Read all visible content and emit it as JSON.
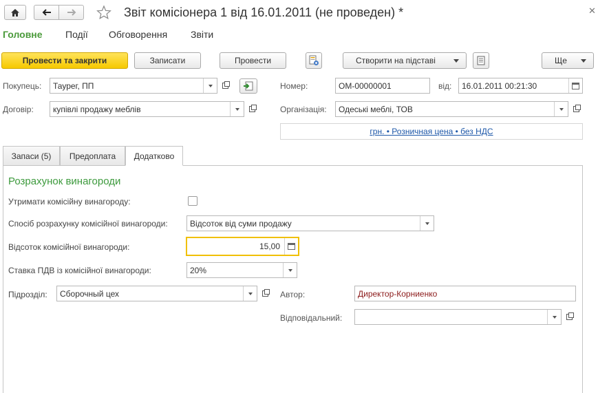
{
  "window": {
    "title": "Звіт комісіонера 1 від 16.01.2011 (не проведен) *"
  },
  "tabs": [
    {
      "label": "Головне",
      "active": true
    },
    {
      "label": "Події",
      "active": false
    },
    {
      "label": "Обговорення",
      "active": false
    },
    {
      "label": "Звіти",
      "active": false
    }
  ],
  "toolbar": {
    "post_close": "Провести та закрити",
    "save": "Записати",
    "post": "Провести",
    "create_based": "Створити на підставі",
    "more": "Ще"
  },
  "header": {
    "buyer_label": "Покупець:",
    "buyer_value": "Таурег, ПП",
    "contract_label": "Договір:",
    "contract_value": "купівлі продажу меблів",
    "number_label": "Номер:",
    "number_value": "ОМ-00000001",
    "date_label": "від:",
    "date_value": "16.01.2011 00:21:30",
    "org_label": "Організація:",
    "org_value": "Одеські меблі, ТОВ",
    "price_link": "грн. • Розничная цена • без НДС"
  },
  "doc_tabs": [
    {
      "label": "Запаси (5)",
      "active": false
    },
    {
      "label": "Предоплата",
      "active": false
    },
    {
      "label": "Додатково",
      "active": true
    }
  ],
  "commission": {
    "section_title": "Розрахунок винагороди",
    "withhold_label": "Утримати комісійну винагороду:",
    "withhold_checked": false,
    "method_label": "Спосіб розрахунку комісійної винагороди:",
    "method_value": "Відсоток від суми продажу",
    "percent_label": "Відсоток комісійної винагороди:",
    "percent_value": "15,00",
    "vat_label": "Ставка ПДВ із комісійної винагороди:",
    "vat_value": "20%",
    "department_label": "Підрозділ:",
    "department_value": "Сборочный цех",
    "author_label": "Автор:",
    "author_value": "Директор-Корниенко",
    "responsible_label": "Відповідальний:",
    "responsible_value": ""
  },
  "colors": {
    "accent_green": "#4a9a3a",
    "primary_button": "#f6c900",
    "link_blue": "#1d57a8",
    "author_text": "#8b1a1a",
    "focus_border": "#f0c000"
  }
}
